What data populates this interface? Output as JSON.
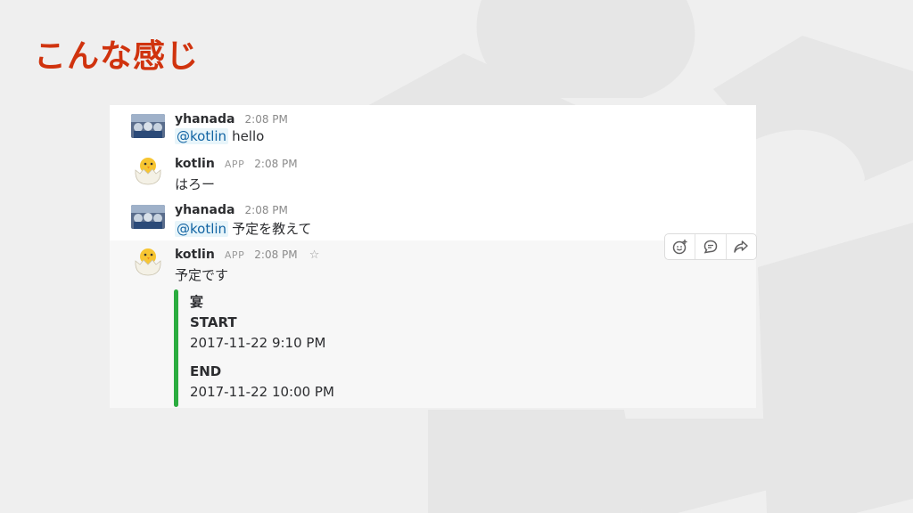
{
  "slide": {
    "title": "こんな感じ",
    "title_color": "#d0330e"
  },
  "messages": [
    {
      "author": "yhanada",
      "time": "2:08 PM",
      "mention": "@kotlin",
      "text": "hello"
    },
    {
      "author": "kotlin",
      "app_tag": "APP",
      "time": "2:08 PM",
      "text": "はろー"
    },
    {
      "author": "yhanada",
      "time": "2:08 PM",
      "mention": "@kotlin",
      "text": "予定を教えて"
    },
    {
      "author": "kotlin",
      "app_tag": "APP",
      "time": "2:08 PM",
      "text": "予定です",
      "star_icon": "star-outline-icon",
      "attachment": {
        "color": "#2bac3f",
        "title": "宴",
        "fields": [
          {
            "label": "START",
            "value": "2017-11-22 9:10 PM"
          },
          {
            "label": "END",
            "value": "2017-11-22 10:00 PM"
          }
        ]
      }
    }
  ],
  "hover_actions": [
    {
      "icon": "add-reaction-icon"
    },
    {
      "icon": "start-thread-icon"
    },
    {
      "icon": "share-message-icon"
    }
  ]
}
